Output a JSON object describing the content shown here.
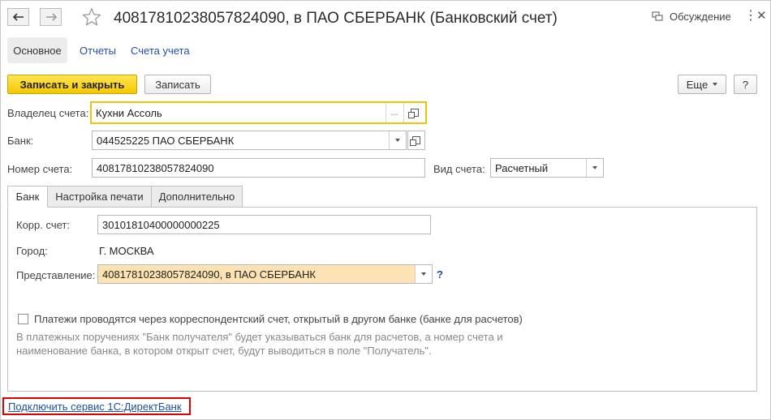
{
  "header": {
    "title": "40817810238057824090, в ПАО СБЕРБАНК (Банковский счет)",
    "discussion_label": "Обсуждение"
  },
  "nav": {
    "main": "Основное",
    "links": [
      "Отчеты",
      "Счета учета"
    ]
  },
  "toolbar": {
    "save_close": "Записать и закрыть",
    "save": "Записать",
    "more": "Еще",
    "help": "?"
  },
  "form": {
    "owner_label": "Владелец счета:",
    "owner_value": "Кухни Ассоль",
    "owner_dots": "...",
    "bank_label": "Банк:",
    "bank_value": "044525225 ПАО СБЕРБАНК",
    "number_label": "Номер счета:",
    "number_value": "40817810238057824090",
    "type_label": "Вид счета:",
    "type_value": "Расчетный"
  },
  "tabs": [
    "Банк",
    "Настройка печати",
    "Дополнительно"
  ],
  "bank_tab": {
    "corr_label": "Корр. счет:",
    "corr_value": "30101810400000000225",
    "city_label": "Город:",
    "city_value": "Г. МОСКВА",
    "repr_label": "Представление:",
    "repr_value": "40817810238057824090, в ПАО СБЕРБАНК",
    "repr_help": "?",
    "checkbox_label": "Платежи проводятся через корреспондентский счет, открытый в другом банке (банке для расчетов)",
    "note_line1": "В платежных поручениях \"Банк получателя\" будет указываться банк для расчетов, а номер счета и",
    "note_line2": "наименование банка, в котором открыт счет, будут выводиться в поле \"Получатель\"."
  },
  "footer": {
    "direct_bank_link": "Подключить сервис 1С:ДиректБанк"
  },
  "colors": {
    "accent_yellow": "#f5c800",
    "link_blue": "#1e4fa3",
    "highlight_red": "#e00000",
    "peach_field": "#fde3b3"
  }
}
